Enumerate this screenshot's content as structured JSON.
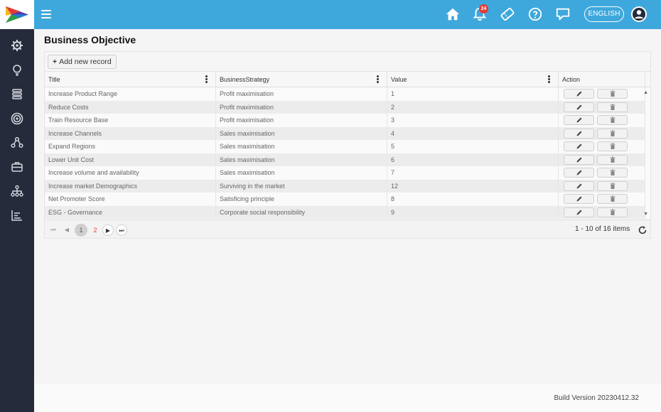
{
  "header": {
    "language_label": "ENGLISH",
    "notification_count": "24",
    "icons": [
      "menu-icon",
      "home-icon",
      "bell-icon",
      "ticket-icon",
      "help-icon",
      "chat-icon",
      "user-icon"
    ]
  },
  "sidebar": {
    "items": [
      "settings-icon",
      "lightbulb-icon",
      "stack-icon",
      "target-icon",
      "network-icon",
      "briefcase-icon",
      "hierarchy-icon",
      "report-icon"
    ]
  },
  "page": {
    "title": "Business Objective"
  },
  "toolbar": {
    "add_label": "Add new record"
  },
  "grid": {
    "columns": [
      "Title",
      "BusinessStrategy",
      "Value",
      "Action"
    ],
    "rows": [
      {
        "title": "Increase Product Range",
        "strategy": "Profit maximisation",
        "value": "1"
      },
      {
        "title": "Reduce Costs",
        "strategy": "Profit maximisation",
        "value": "2"
      },
      {
        "title": "Train Resource Base",
        "strategy": "Profit maximisation",
        "value": "3"
      },
      {
        "title": "Increase Channels",
        "strategy": "Sales maximisation",
        "value": "4"
      },
      {
        "title": "Expand Regions",
        "strategy": "Sales maximisation",
        "value": "5"
      },
      {
        "title": "Lower Unit Cost",
        "strategy": "Sales maximisation",
        "value": "6"
      },
      {
        "title": "Increase volume and availability",
        "strategy": "Sales maximisation",
        "value": "7"
      },
      {
        "title": "Increase market Demographics",
        "strategy": "Surviving in the market",
        "value": "12"
      },
      {
        "title": "Net Promoter Score",
        "strategy": "Satisficing principle",
        "value": "8"
      },
      {
        "title": "ESG - Governance",
        "strategy": "Corporate social responsibility",
        "value": "9"
      }
    ]
  },
  "pager": {
    "pages": [
      "1",
      "2"
    ],
    "current": "1",
    "info": "1 - 10 of 16 items"
  },
  "footer": {
    "build": "Build Version 20230412.32"
  },
  "colors": {
    "topbar": "#3ea8dc",
    "sidebar": "#252b3b",
    "badge": "#e53935"
  }
}
